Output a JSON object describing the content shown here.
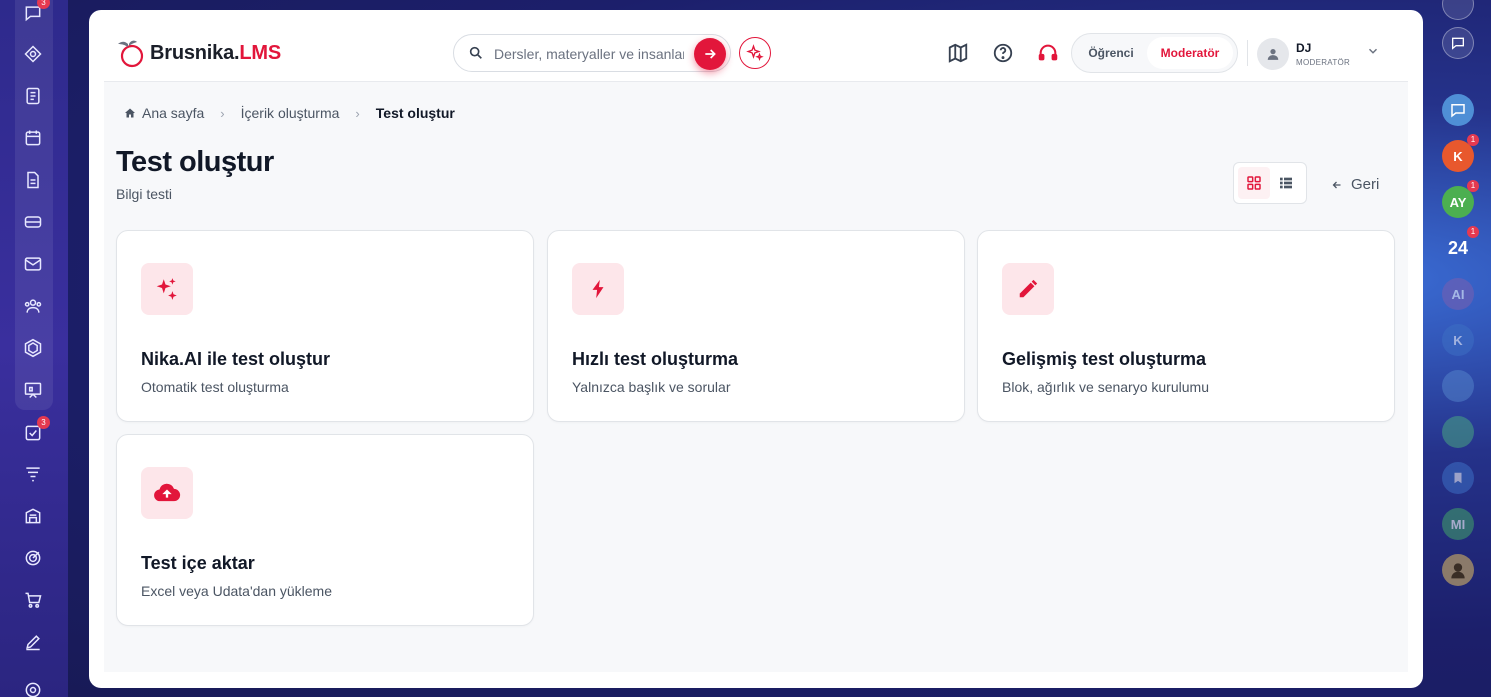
{
  "app": {
    "brand_main": "Brusnika.",
    "brand_accent": "LMS",
    "accent_color": "#e2163b"
  },
  "sidebar": {
    "items": [
      {
        "icon": "chat-icon",
        "badge": "3"
      },
      {
        "icon": "compass-icon"
      },
      {
        "icon": "document-list-icon"
      },
      {
        "icon": "calendar-icon"
      },
      {
        "icon": "file-icon"
      },
      {
        "icon": "card-icon"
      },
      {
        "icon": "mail-icon"
      },
      {
        "icon": "users-icon"
      },
      {
        "icon": "hexagon-icon"
      },
      {
        "icon": "presentation-icon"
      },
      {
        "icon": "checklist-icon",
        "badge": "3"
      },
      {
        "icon": "filter-icon"
      },
      {
        "icon": "building-icon"
      },
      {
        "icon": "target-icon"
      },
      {
        "icon": "cart-icon"
      },
      {
        "icon": "edit-icon"
      },
      {
        "icon": "settings-icon"
      }
    ]
  },
  "search": {
    "placeholder": "Dersler, materyaller ve insanlar"
  },
  "roles": {
    "student": "Öğrenci",
    "moderator": "Moderatör"
  },
  "user": {
    "name": "DJ",
    "role": "MODERATÖR"
  },
  "breadcrumb": {
    "home": "Ana sayfa",
    "middle": "İçerik oluşturma",
    "current": "Test oluştur"
  },
  "page": {
    "title": "Test oluştur",
    "subtitle": "Bilgi testi",
    "back_label": "Geri"
  },
  "cards": [
    {
      "title": "Nika.AI ile test oluştur",
      "desc": "Otomatik test oluşturma",
      "icon": "sparkles-icon"
    },
    {
      "title": "Hızlı test oluşturma",
      "desc": "Yalnızca başlık ve sorular",
      "icon": "lightning-icon"
    },
    {
      "title": "Gelişmiş test oluşturma",
      "desc": "Blok, ağırlık ve senaryo kurulumu",
      "icon": "pencil-icon"
    },
    {
      "title": "Test içe aktar",
      "desc": "Excel veya Udata'dan yükleme",
      "icon": "cloud-upload-icon"
    }
  ],
  "rightrail": {
    "items": [
      {
        "label": "K",
        "color": "#e8582d",
        "badge": "1"
      },
      {
        "label": "AY",
        "color": "#4caf50",
        "badge": "1"
      },
      {
        "label": "24",
        "color": "#1565c0",
        "badge": "1"
      },
      {
        "label": "AI",
        "color": "#7a5fb0"
      },
      {
        "label": "K",
        "color": "#3d6fc4"
      },
      {
        "label": "MI",
        "color": "#3f9a6a"
      }
    ]
  }
}
